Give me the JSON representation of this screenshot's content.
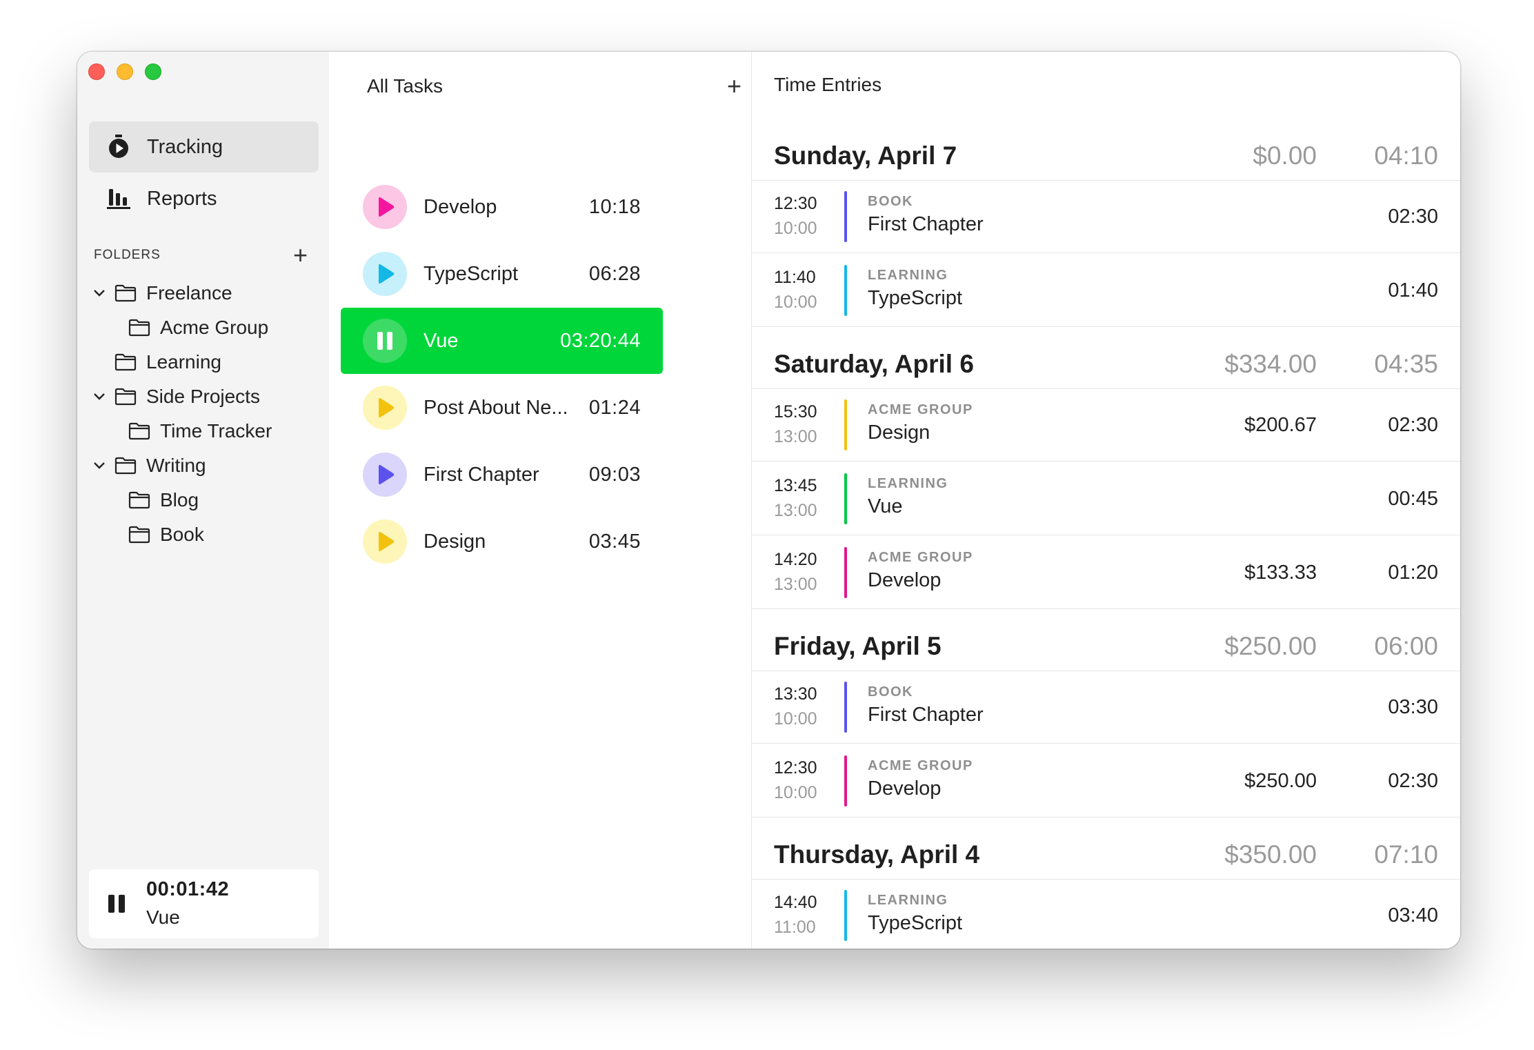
{
  "sidebar": {
    "nav": [
      {
        "label": "Tracking",
        "icon": "stopwatch-icon",
        "selected": true
      },
      {
        "label": "Reports",
        "icon": "bar-chart-icon",
        "selected": false
      }
    ],
    "folders_label": "FOLDERS",
    "tree": [
      {
        "label": "Freelance",
        "depth": 0,
        "expanded": true
      },
      {
        "label": "Acme Group",
        "depth": 1
      },
      {
        "label": "Learning",
        "depth": 0
      },
      {
        "label": "Side Projects",
        "depth": 0,
        "expanded": true
      },
      {
        "label": "Time Tracker",
        "depth": 1
      },
      {
        "label": "Writing",
        "depth": 0,
        "expanded": true
      },
      {
        "label": "Blog",
        "depth": 1
      },
      {
        "label": "Book",
        "depth": 1
      }
    ],
    "mini_timer": {
      "time": "00:01:42",
      "task": "Vue"
    }
  },
  "tasks": {
    "title": "All Tasks",
    "items": [
      {
        "name": "Develop",
        "duration": "10:18",
        "color": "#f4179d",
        "bg": "#fcc6e5",
        "active": false
      },
      {
        "name": "TypeScript",
        "duration": "06:28",
        "color": "#14b8e6",
        "bg": "#c6f0fb",
        "active": false
      },
      {
        "name": "Vue",
        "duration": "03:20:44",
        "color": "#ffffff",
        "bg": "#3ddb66",
        "active": true
      },
      {
        "name": "Post About Ne...",
        "duration": "01:24",
        "color": "#f2c20f",
        "bg": "#fdf6b8",
        "active": false
      },
      {
        "name": "First Chapter",
        "duration": "09:03",
        "color": "#5b52ee",
        "bg": "#d9d5fb",
        "active": false
      },
      {
        "name": "Design",
        "duration": "03:45",
        "color": "#f2c20f",
        "bg": "#fdf6b8",
        "active": false
      }
    ]
  },
  "entries": {
    "title": "Time Entries",
    "days": [
      {
        "date": "Sunday, April 7",
        "amount": "$0.00",
        "total": "04:10",
        "items": [
          {
            "end": "12:30",
            "start": "10:00",
            "folder": "BOOK",
            "task": "First Chapter",
            "amount": "",
            "duration": "02:30",
            "color": "#5b52ee"
          },
          {
            "end": "11:40",
            "start": "10:00",
            "folder": "LEARNING",
            "task": "TypeScript",
            "amount": "",
            "duration": "01:40",
            "color": "#14b8e6"
          }
        ]
      },
      {
        "date": "Saturday, April 6",
        "amount": "$334.00",
        "total": "04:35",
        "items": [
          {
            "end": "15:30",
            "start": "13:00",
            "folder": "ACME GROUP",
            "task": "Design",
            "amount": "$200.67",
            "duration": "02:30",
            "color": "#f2c20f"
          },
          {
            "end": "13:45",
            "start": "13:00",
            "folder": "LEARNING",
            "task": "Vue",
            "amount": "",
            "duration": "00:45",
            "color": "#00c842"
          },
          {
            "end": "14:20",
            "start": "13:00",
            "folder": "ACME GROUP",
            "task": "Develop",
            "amount": "$133.33",
            "duration": "01:20",
            "color": "#e0168f"
          }
        ]
      },
      {
        "date": "Friday, April 5",
        "amount": "$250.00",
        "total": "06:00",
        "items": [
          {
            "end": "13:30",
            "start": "10:00",
            "folder": "BOOK",
            "task": "First Chapter",
            "amount": "",
            "duration": "03:30",
            "color": "#5b52ee"
          },
          {
            "end": "12:30",
            "start": "10:00",
            "folder": "ACME GROUP",
            "task": "Develop",
            "amount": "$250.00",
            "duration": "02:30",
            "color": "#e0168f"
          }
        ]
      },
      {
        "date": "Thursday, April 4",
        "amount": "$350.00",
        "total": "07:10",
        "items": [
          {
            "end": "14:40",
            "start": "11:00",
            "folder": "LEARNING",
            "task": "TypeScript",
            "amount": "",
            "duration": "03:40",
            "color": "#14b8e6"
          }
        ]
      }
    ]
  }
}
